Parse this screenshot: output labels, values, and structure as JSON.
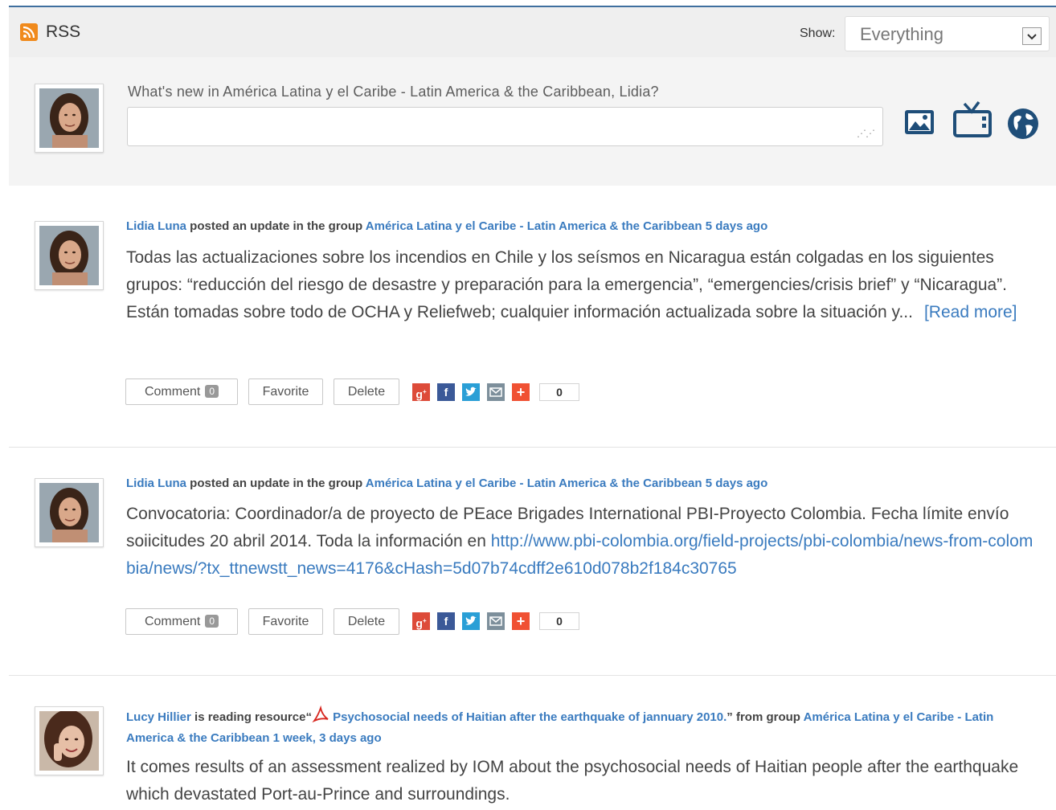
{
  "toolbar": {
    "rss_label": "RSS",
    "show_label": "Show:",
    "show_value": "Everything"
  },
  "composer": {
    "prompt": "What's new in América Latina y el Caribe - Latin America & the Caribbean, Lidia?",
    "icons": [
      "photo-icon",
      "video-icon",
      "link-globe-icon"
    ]
  },
  "posts": [
    {
      "user": "Lidia Luna",
      "action": "posted an update in the group",
      "group": "América Latina y el Caribe - Latin America & the Caribbean",
      "time": "5 days ago",
      "body": "Todas las actualizaciones sobre los incendios en Chile y los seísmos en Nicaragua están colgadas en los siguientes grupos: “reducción del riesgo de desastre y preparación para la emergencia”, “emergencies/crisis brief” y “Nicaragua”. Están tomadas sobre todo de OCHA y Reliefweb; cualquier información actualizada sobre la situación y...",
      "read_more": "[Read more]",
      "comment_label": "Comment",
      "comment_count": "0",
      "favorite_label": "Favorite",
      "delete_label": "Delete",
      "share_count": "0"
    },
    {
      "user": "Lidia Luna",
      "action": "posted an update in the group",
      "group": "América Latina y el Caribe - Latin America & the Caribbean",
      "time": "5 days ago",
      "body": "Convocatoria: Coordinador/a de proyecto de PEace Brigades International PBI-Proyecto Colombia. Fecha límite envío soiicitudes 20 abril 2014. Toda la información en",
      "link": "http://www.pbi-colombia.org/field-projects/pbi-colombia/news-from-colombia/news/?tx_ttnewstt_news=4176&cHash=5d07b74cdff2e610d078b2f184c30765",
      "comment_label": "Comment",
      "comment_count": "0",
      "favorite_label": "Favorite",
      "delete_label": "Delete",
      "share_count": "0"
    },
    {
      "user": "Lucy Hillier",
      "action": "is reading resource",
      "open_quote": "“",
      "resource": "Psychosocial needs of Haitian after the earthquake of jannuary 2010.",
      "close_quote": "” from group",
      "group": "América Latina y el Caribe - Latin America & the Caribbean",
      "time": "1 week, 3 days ago",
      "body": "It comes results of an assessment realized by IOM about the psychosocial needs of Haitian people after the earthquake which devastated Port-au-Prince and surroundings."
    }
  ],
  "colors": {
    "link": "#3a7bbf",
    "rss": "#f08a1c",
    "icon_dark": "#1f4e79",
    "google": "#dd4b39",
    "facebook": "#3b5998",
    "twitter": "#2a9fd6",
    "email": "#7d8f9b",
    "addthis": "#f05133"
  }
}
